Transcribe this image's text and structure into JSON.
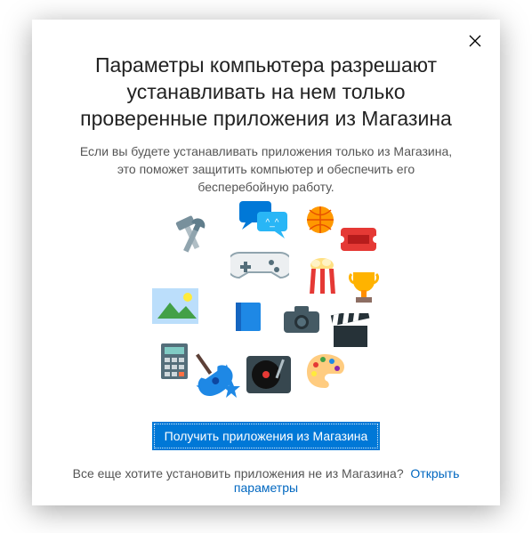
{
  "title": "Параметры компьютера разрешают устанавливать на нем только проверенные приложения из Магазина",
  "subtitle": "Если вы будете устанавливать приложения только из Магазина, это поможет защитить компьютер и обеспечить его бесперебойную работу.",
  "cta": "Получить приложения из Магазина",
  "question": "Все еще хотите установить приложения не из Магазина?",
  "link": "Открыть параметры",
  "icons": [
    "tools",
    "chat",
    "basketball",
    "ticket",
    "gamepad",
    "popcorn",
    "trophy",
    "picture",
    "book",
    "camera",
    "clapperboard",
    "calculator",
    "guitar",
    "star",
    "turntable",
    "palette"
  ],
  "colors": {
    "accent": "#0078d7",
    "link": "#0067c0"
  }
}
